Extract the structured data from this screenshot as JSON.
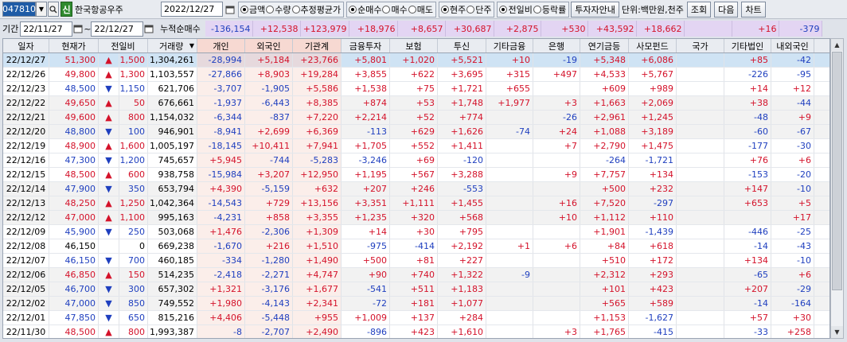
{
  "toolbar": {
    "code": "047810",
    "sin_label": "신",
    "stock_name": "한국항공우주",
    "date": "2022/12/27",
    "unit_group": [
      {
        "label": "금액",
        "on": true
      },
      {
        "label": "수량",
        "on": false
      },
      {
        "label": "추정평균가",
        "on": false
      }
    ],
    "trade_group": [
      {
        "label": "순매수",
        "on": true
      },
      {
        "label": "매수",
        "on": false
      },
      {
        "label": "매도",
        "on": false
      }
    ],
    "price_group": [
      {
        "label": "현주",
        "on": true
      },
      {
        "label": "단주",
        "on": false
      }
    ],
    "compare_group": [
      {
        "label": "전일비",
        "on": true
      },
      {
        "label": "등락률",
        "on": false
      }
    ],
    "guide_btn": "투자자안내",
    "unit_text": "단위:백만원,천주",
    "query_btn": "조회",
    "next_btn": "다음",
    "chart_btn": "차트"
  },
  "period": {
    "label": "기간",
    "from": "22/11/27",
    "tilde": "~",
    "to": "22/12/27",
    "cum_label": "누적순매수",
    "cum_values": [
      "-136,154",
      "+12,538",
      "+123,979",
      "+18,976",
      "+8,657",
      "+30,687",
      "+2,875",
      "+530",
      "+43,592",
      "+18,662",
      "",
      "+16",
      "-379"
    ]
  },
  "columns": [
    "일자",
    "현재가",
    "전일비",
    "거래량",
    "개인",
    "외국인",
    "기관계",
    "금융투자",
    "보험",
    "투신",
    "기타금융",
    "은행",
    "연기금등",
    "사모펀드",
    "국가",
    "기타법인",
    "내외국인"
  ],
  "rows": [
    [
      "22/12/27",
      "51,300",
      "▲",
      "1,500",
      "1,304,261",
      "-28,994",
      "+5,184",
      "+23,766",
      "+5,801",
      "+1,020",
      "+5,521",
      "+10",
      "-19",
      "+5,348",
      "+6,086",
      "",
      "+85",
      "-42"
    ],
    [
      "22/12/26",
      "49,800",
      "▲",
      "1,300",
      "1,103,557",
      "-27,866",
      "+8,903",
      "+19,284",
      "+3,855",
      "+622",
      "+3,695",
      "+315",
      "+497",
      "+4,533",
      "+5,767",
      "",
      "-226",
      "-95"
    ],
    [
      "22/12/23",
      "48,500",
      "▼",
      "1,150",
      "621,706",
      "-3,707",
      "-1,905",
      "+5,586",
      "+1,538",
      "+75",
      "+1,721",
      "+655",
      "",
      "+609",
      "+989",
      "",
      "+14",
      "+12"
    ],
    [
      "22/12/22",
      "49,650",
      "▲",
      "50",
      "676,661",
      "-1,937",
      "-6,443",
      "+8,385",
      "+874",
      "+53",
      "+1,748",
      "+1,977",
      "+3",
      "+1,663",
      "+2,069",
      "",
      "+38",
      "-44"
    ],
    [
      "22/12/21",
      "49,600",
      "▲",
      "800",
      "1,154,032",
      "-6,344",
      "-837",
      "+7,220",
      "+2,214",
      "+52",
      "+774",
      "",
      "-26",
      "+2,961",
      "+1,245",
      "",
      "-48",
      "+9"
    ],
    [
      "22/12/20",
      "48,800",
      "▼",
      "100",
      "946,901",
      "-8,941",
      "+2,699",
      "+6,369",
      "-113",
      "+629",
      "+1,626",
      "-74",
      "+24",
      "+1,088",
      "+3,189",
      "",
      "-60",
      "-67"
    ],
    [
      "22/12/19",
      "48,900",
      "▲",
      "1,600",
      "1,005,197",
      "-18,145",
      "+10,411",
      "+7,941",
      "+1,705",
      "+552",
      "+1,411",
      "",
      "+7",
      "+2,790",
      "+1,475",
      "",
      "-177",
      "-30"
    ],
    [
      "22/12/16",
      "47,300",
      "▼",
      "1,200",
      "745,657",
      "+5,945",
      "-744",
      "-5,283",
      "-3,246",
      "+69",
      "-120",
      "",
      "",
      "-264",
      "-1,721",
      "",
      "+76",
      "+6"
    ],
    [
      "22/12/15",
      "48,500",
      "▲",
      "600",
      "938,758",
      "-15,984",
      "+3,207",
      "+12,950",
      "+1,195",
      "+567",
      "+3,288",
      "",
      "+9",
      "+7,757",
      "+134",
      "",
      "-153",
      "-20"
    ],
    [
      "22/12/14",
      "47,900",
      "▼",
      "350",
      "653,794",
      "+4,390",
      "-5,159",
      "+632",
      "+207",
      "+246",
      "-553",
      "",
      "",
      "+500",
      "+232",
      "",
      "+147",
      "-10"
    ],
    [
      "22/12/13",
      "48,250",
      "▲",
      "1,250",
      "1,042,364",
      "-14,543",
      "+729",
      "+13,156",
      "+3,351",
      "+1,111",
      "+1,455",
      "",
      "+16",
      "+7,520",
      "-297",
      "",
      "+653",
      "+5"
    ],
    [
      "22/12/12",
      "47,000",
      "▲",
      "1,100",
      "995,163",
      "-4,231",
      "+858",
      "+3,355",
      "+1,235",
      "+320",
      "+568",
      "",
      "+10",
      "+1,112",
      "+110",
      "",
      "",
      "+17"
    ],
    [
      "22/12/09",
      "45,900",
      "▼",
      "250",
      "503,068",
      "+1,476",
      "-2,306",
      "+1,309",
      "+14",
      "+30",
      "+795",
      "",
      "",
      "+1,901",
      "-1,439",
      "",
      "-446",
      "-25"
    ],
    [
      "22/12/08",
      "46,150",
      "",
      "0",
      "669,238",
      "-1,670",
      "+216",
      "+1,510",
      "-975",
      "-414",
      "+2,192",
      "+1",
      "+6",
      "+84",
      "+618",
      "",
      "-14",
      "-43"
    ],
    [
      "22/12/07",
      "46,150",
      "▼",
      "700",
      "460,185",
      "-334",
      "-1,280",
      "+1,490",
      "+500",
      "+81",
      "+227",
      "",
      "",
      "+510",
      "+172",
      "",
      "+134",
      "-10"
    ],
    [
      "22/12/06",
      "46,850",
      "▲",
      "150",
      "514,235",
      "-2,418",
      "-2,271",
      "+4,747",
      "+90",
      "+740",
      "+1,322",
      "-9",
      "",
      "+2,312",
      "+293",
      "",
      "-65",
      "+6"
    ],
    [
      "22/12/05",
      "46,700",
      "▼",
      "300",
      "657,302",
      "+1,321",
      "-3,176",
      "+1,677",
      "-541",
      "+511",
      "+1,183",
      "",
      "",
      "+101",
      "+423",
      "",
      "+207",
      "-29"
    ],
    [
      "22/12/02",
      "47,000",
      "▼",
      "850",
      "749,552",
      "+1,980",
      "-4,143",
      "+2,341",
      "-72",
      "+181",
      "+1,077",
      "",
      "",
      "+565",
      "+589",
      "",
      "-14",
      "-164"
    ],
    [
      "22/12/01",
      "47,850",
      "▼",
      "650",
      "815,216",
      "+4,406",
      "-5,448",
      "+955",
      "+1,009",
      "+137",
      "+284",
      "",
      "",
      "+1,153",
      "-1,627",
      "",
      "+57",
      "+30"
    ],
    [
      "22/11/30",
      "48,500",
      "▲",
      "800",
      "1,993,387",
      "-8",
      "-2,707",
      "+2,490",
      "-896",
      "+423",
      "+1,610",
      "",
      "+3",
      "+1,765",
      "-415",
      "",
      "-33",
      "+258"
    ]
  ]
}
